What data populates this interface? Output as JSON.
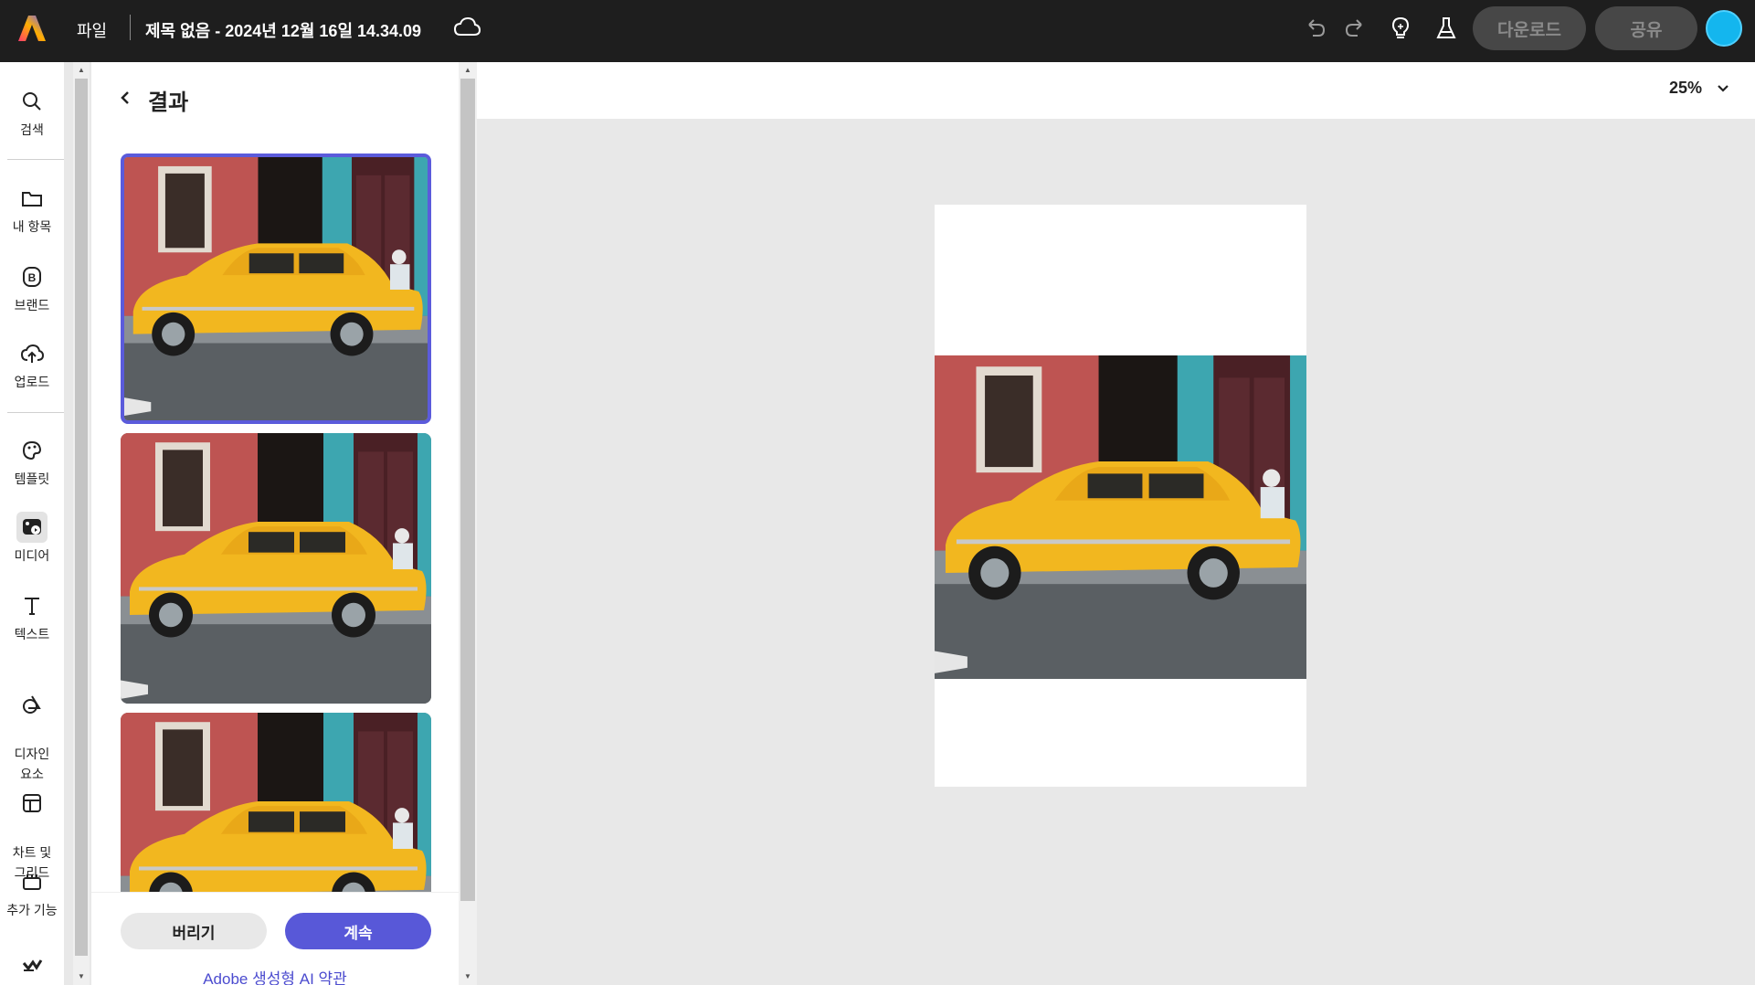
{
  "topbar": {
    "file_menu": "파일",
    "doc_title": "제목 없음 - 2024년 12월 16일 14.34.09",
    "download_label": "다운로드",
    "share_label": "공유"
  },
  "rail": {
    "items": [
      {
        "label": "검색",
        "icon": "search-icon"
      },
      {
        "label": "내 항목",
        "icon": "folder-icon"
      },
      {
        "label": "브랜드",
        "icon": "brand-icon"
      },
      {
        "label": "업로드",
        "icon": "upload-icon"
      },
      {
        "label": "템플릿",
        "icon": "template-icon"
      },
      {
        "label": "미디어",
        "icon": "media-icon"
      },
      {
        "label": "텍스트",
        "icon": "text-icon"
      },
      {
        "label": "디자인\n요소",
        "icon": "design-elements-icon"
      },
      {
        "label": "차트 및\n그리드",
        "icon": "chart-grid-icon"
      },
      {
        "label": "추가 기능",
        "icon": "addons-icon"
      }
    ],
    "active": "미디어"
  },
  "panel": {
    "title": "결과",
    "discard_label": "버리기",
    "continue_label": "계속",
    "terms_link": "Adobe 생성형 AI 약관"
  },
  "canvas": {
    "zoom": "25%"
  },
  "colors": {
    "topbar": "#1e1e1e",
    "accent": "#5858d8",
    "avatar": "#14b6ee",
    "car": "#f2b71f"
  }
}
